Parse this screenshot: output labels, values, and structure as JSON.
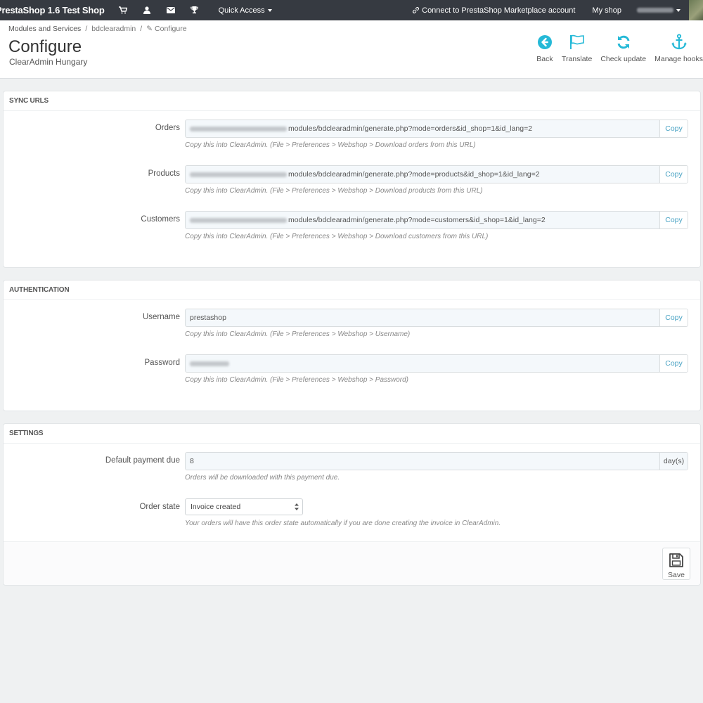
{
  "topbar": {
    "brand": "PrestaShop 1.6 Test Shop",
    "icons": [
      "cart-icon",
      "user-icon",
      "envelope-icon",
      "trophy-icon"
    ],
    "quick_access": "Quick Access",
    "connect": "Connect to PrestaShop Marketplace account",
    "my_shop": "My shop"
  },
  "header": {
    "breadcrumb": [
      "Modules and Services",
      "bdclearadmin",
      "Configure"
    ],
    "title": "Configure",
    "subtitle": "ClearAdmin Hungary",
    "toolbar": [
      {
        "label": "Back",
        "icon": "arrow-circle-left-icon"
      },
      {
        "label": "Translate",
        "icon": "flag-icon"
      },
      {
        "label": "Check update",
        "icon": "refresh-icon"
      },
      {
        "label": "Manage hooks",
        "icon": "anchor-icon"
      }
    ]
  },
  "sync_urls": {
    "heading": "SYNC URLS",
    "rows": [
      {
        "label": "Orders",
        "value": "modules/bdclearadmin/generate.php?mode=orders&id_shop=1&id_lang=2",
        "button": "Copy",
        "help": "Copy this into ClearAdmin. (File > Preferences > Webshop > Download orders from this URL)"
      },
      {
        "label": "Products",
        "value": "modules/bdclearadmin/generate.php?mode=products&id_shop=1&id_lang=2",
        "button": "Copy",
        "help": "Copy this into ClearAdmin. (File > Preferences > Webshop > Download products from this URL)"
      },
      {
        "label": "Customers",
        "value": "modules/bdclearadmin/generate.php?mode=customers&id_shop=1&id_lang=2",
        "button": "Copy",
        "help": "Copy this into ClearAdmin. (File > Preferences > Webshop > Download customers from this URL)"
      }
    ]
  },
  "authentication": {
    "heading": "AUTHENTICATION",
    "rows": [
      {
        "label": "Username",
        "value": "prestashop",
        "button": "Copy",
        "help": "Copy this into ClearAdmin. (File > Preferences > Webshop > Username)"
      },
      {
        "label": "Password",
        "value": "",
        "button": "Copy",
        "help": "Copy this into ClearAdmin. (File > Preferences > Webshop > Password)"
      }
    ]
  },
  "settings": {
    "heading": "SETTINGS",
    "payment_due": {
      "label": "Default payment due",
      "value": "8",
      "suffix": "day(s)",
      "help": "Orders will be downloaded with this payment due."
    },
    "order_state": {
      "label": "Order state",
      "selected": "Invoice created",
      "help": "Your orders will have this order state automatically if you are done creating the invoice in ClearAdmin."
    },
    "save": "Save"
  },
  "colors": {
    "topbar": "#363a41",
    "accent": "#25b9d7",
    "link": "#4aa3c4"
  }
}
